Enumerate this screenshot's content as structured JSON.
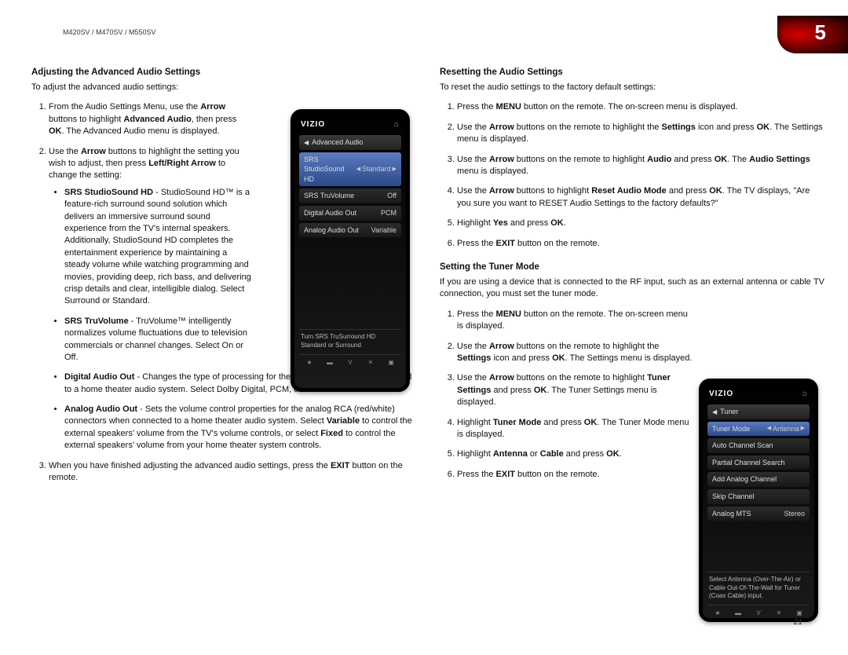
{
  "header": {
    "model": "M420SV / M470SV / M550SV",
    "chapter": "5"
  },
  "page_number": "21",
  "left": {
    "h1": "Adjusting the Advanced Audio Settings",
    "intro": "To adjust the advanced audio settings:",
    "step1_a": "From the Audio Settings Menu, use the ",
    "step1_b": "Arrow",
    "step1_c": " buttons to highlight ",
    "step1_d": "Advanced Audio",
    "step1_e": ", then press ",
    "step1_f": "OK",
    "step1_g": ". The Advanced Audio menu is displayed.",
    "step2_a": "Use the ",
    "step2_b": "Arrow",
    "step2_c": " buttons to highlight the setting you wish to adjust, then press ",
    "step2_d": "Left/Right Arrow",
    "step2_e": " to change the setting:",
    "b1_t": "SRS StudioSound HD",
    "b1_d": " - StudioSound HD™ is a feature-rich surround sound solution which delivers an immersive surround sound experience from the TV's internal speakers. Additionally, StudioSound HD completes the entertainment experience by maintaining a steady volume while watching programming and movies, providing deep, rich bass, and delivering crisp details and clear, intelligible dialog. Select Surround or Standard.",
    "b2_t": "SRS TruVolume",
    "b2_d": " - TruVolume™ intelligently normalizes volume fluctuations due to television commercials or channel changes. Select On or Off.",
    "b3_t": "Digital Audio Out",
    "b3_d": " - Changes the type of processing for the Optical output when connected to a home theater audio system. Select Dolby Digital, PCM, or Off.",
    "b4_t": "Analog Audio Out",
    "b4_d1": " - Sets the volume control properties for the analog RCA (red/white) connectors when connected to a home theater audio system. Select ",
    "b4_v": "Variable",
    "b4_d2": " to control the external speakers' volume from the TV's volume controls, or select ",
    "b4_f": "Fixed",
    "b4_d3": " to control the external speakers' volume from your home theater system controls.",
    "step3_a": "When you have finished adjusting the advanced audio settings, press the ",
    "step3_b": "EXIT",
    "step3_c": " button on the remote."
  },
  "osd1": {
    "brand": "VIZIO",
    "crumb": "Advanced Audio",
    "rows": [
      {
        "l": "SRS StudioSound HD",
        "v": "Standard",
        "sel": true,
        "arr": true
      },
      {
        "l": "SRS TruVolume",
        "v": "Off"
      },
      {
        "l": "Digital Audio Out",
        "v": "PCM"
      },
      {
        "l": "Analog Audio Out",
        "v": "Variable"
      }
    ],
    "help": "Turn SRS TruSurround HD Standard or Surround"
  },
  "right": {
    "h1": "Resetting the Audio Settings",
    "intro": "To reset the audio settings to the factory default settings:",
    "r1_a": "Press the ",
    "r1_b": "MENU",
    "r1_c": " button on the remote. The on-screen menu is displayed.",
    "r2_a": "Use the ",
    "r2_b": "Arrow",
    "r2_c": " buttons on the remote to highlight the ",
    "r2_d": "Settings",
    "r2_e": " icon and press ",
    "r2_f": "OK",
    "r2_g": ". The Settings menu is displayed.",
    "r3_a": "Use the ",
    "r3_b": "Arrow",
    "r3_c": " buttons on the remote to highlight ",
    "r3_d": "Audio",
    "r3_e": " and press ",
    "r3_f": "OK",
    "r3_g": ". The ",
    "r3_h": "Audio Settings",
    "r3_i": " menu is displayed.",
    "r4_a": "Use the ",
    "r4_b": "Arrow",
    "r4_c": " buttons to highlight ",
    "r4_d": "Reset Audio Mode",
    "r4_e": " and press ",
    "r4_f": "OK",
    "r4_g": ". The TV displays, \"Are you sure you want to RESET Audio Settings to the factory defaults?\"",
    "r5_a": "Highlight ",
    "r5_b": "Yes",
    "r5_c": " and press ",
    "r5_d": "OK",
    "r5_e": ".",
    "r6_a": "Press the ",
    "r6_b": "EXIT",
    "r6_c": " button on the remote.",
    "h2": "Setting the Tuner Mode",
    "intro2": "If you are using a device that is connected to the RF input, such as an external antenna or cable TV connection, you must set the tuner mode.",
    "t1_a": "Press the ",
    "t1_b": "MENU",
    "t1_c": " button on the remote. The on-screen menu is displayed.",
    "t2_a": "Use the ",
    "t2_b": "Arrow",
    "t2_c": " buttons on the remote to highlight the ",
    "t2_d": "Settings",
    "t2_e": " icon and press ",
    "t2_f": "OK",
    "t2_g": ". The Settings menu is displayed.",
    "t3_a": "Use the ",
    "t3_b": "Arrow",
    "t3_c": " buttons on the remote to highlight ",
    "t3_d": "Tuner Settings",
    "t3_e": " and press ",
    "t3_f": "OK",
    "t3_g": ". The Tuner Settings menu is displayed.",
    "t4_a": "Highlight ",
    "t4_b": "Tuner Mode",
    "t4_c": " and press ",
    "t4_d": "OK",
    "t4_e": ". The Tuner Mode menu is displayed.",
    "t5_a": "Highlight ",
    "t5_b": "Antenna",
    "t5_c": " or ",
    "t5_d": "Cable",
    "t5_e": " and press ",
    "t5_f": "OK",
    "t5_g": ".",
    "t6_a": "Press the ",
    "t6_b": "EXIT",
    "t6_c": " button on the remote."
  },
  "osd2": {
    "brand": "VIZIO",
    "crumb": "Tuner",
    "rows": [
      {
        "l": "Tuner Mode",
        "v": "Antenna",
        "sel": true,
        "arr": true
      },
      {
        "l": "Auto Channel Scan",
        "v": ""
      },
      {
        "l": "Partial Channel Search",
        "v": ""
      },
      {
        "l": "Add Analog Channel",
        "v": ""
      },
      {
        "l": "Skip Channel",
        "v": ""
      },
      {
        "l": "Analog MTS",
        "v": "Stereo"
      }
    ],
    "help": "Select Antenna (Over-The-Air) or Cable Out-Of-The-Wall for Tuner (Coax Cable) input."
  },
  "footer_icons": [
    "★",
    "▬",
    "V",
    "✕",
    "▣"
  ]
}
